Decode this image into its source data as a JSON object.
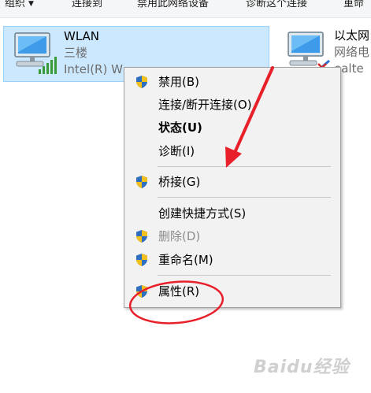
{
  "toolbar": {
    "organize": "组织",
    "connect_to": "连接到",
    "disable_device": "禁用此网络设备",
    "diagnose": "诊断这个连接",
    "rename": "重命"
  },
  "tiles": {
    "wlan": {
      "name": "WLAN",
      "network": "三楼",
      "adapter": "Intel(R) W"
    },
    "ethernet": {
      "name": "以太网",
      "network": "网络电",
      "adapter": "ealte"
    }
  },
  "context_menu": {
    "items": [
      {
        "label": "禁用(B)",
        "shield": true,
        "enabled": true,
        "bold": false
      },
      {
        "label": "连接/断开连接(O)",
        "shield": false,
        "enabled": true,
        "bold": false
      },
      {
        "label": "状态(U)",
        "shield": false,
        "enabled": true,
        "bold": true
      },
      {
        "label": "诊断(I)",
        "shield": false,
        "enabled": true,
        "bold": false
      },
      {
        "label": "桥接(G)",
        "shield": true,
        "enabled": true,
        "bold": false
      },
      {
        "label": "创建快捷方式(S)",
        "shield": false,
        "enabled": true,
        "bold": false
      },
      {
        "label": "删除(D)",
        "shield": true,
        "enabled": false,
        "bold": false
      },
      {
        "label": "重命名(M)",
        "shield": true,
        "enabled": true,
        "bold": false
      },
      {
        "label": "属性(R)",
        "shield": true,
        "enabled": true,
        "bold": false
      }
    ]
  },
  "annotations": {
    "arrow_color": "#e8202a",
    "circle_color": "#e8202a"
  },
  "watermark": "Baidu经验"
}
